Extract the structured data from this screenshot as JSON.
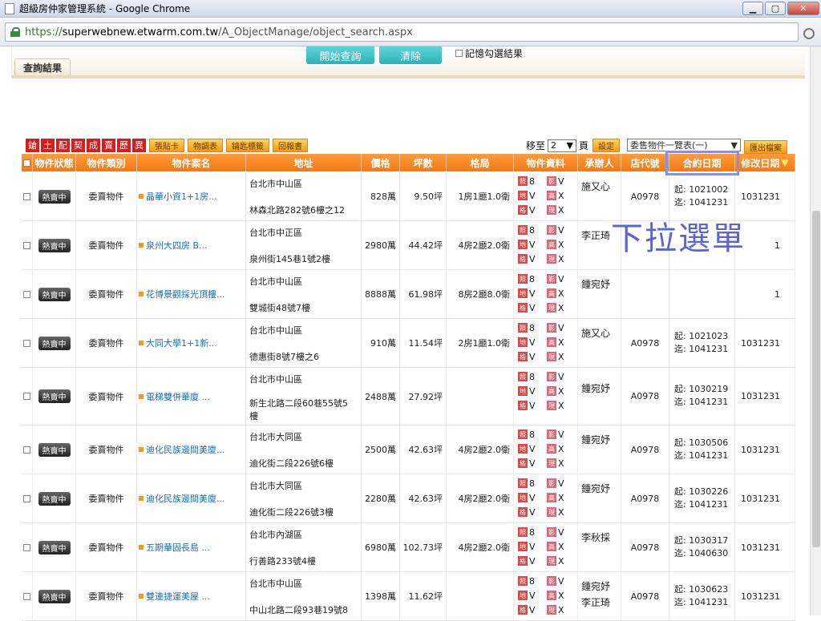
{
  "window": {
    "title": "超級房仲家管理系統 - Google Chrome",
    "min": "▁",
    "max": "▢",
    "close": "✕"
  },
  "address": {
    "scheme": "https://",
    "host": "superwebnew.etwarm.com.tw",
    "path": "/A_ObjectManage/object_search.aspx"
  },
  "search": {
    "start_label": "開始查詢",
    "clear_label": "清除",
    "remember_label": "記憶勾選結果"
  },
  "results": {
    "tab_label": "查詢結果",
    "red_buttons": [
      "鎗",
      "土",
      "配",
      "契",
      "成",
      "賣",
      "歷",
      "異"
    ],
    "orange_buttons": [
      "張貼卡",
      "物調表",
      "鑰匙標籤",
      "回報書"
    ],
    "goto_label": "移至",
    "page_value": "2",
    "page_unit": "頁",
    "set_label": "設定",
    "view_select": "委售物件一覽表(一)",
    "export_label": "匯出檔案"
  },
  "columns": [
    "物件狀態",
    "物件類別",
    "物件案名",
    "地址",
    "價格",
    "坪數",
    "格局",
    "物件資料",
    "承辦人",
    "店代號",
    "合約日期",
    "修改日期"
  ],
  "sort_indicator": "▼",
  "info_labels": {
    "a1": "照",
    "a2": "影",
    "b1": "地",
    "b2": "高",
    "c1": "格",
    "c2": "現"
  },
  "rows": [
    {
      "status": "熱賣中",
      "category": "委賣物件",
      "name": "晶華小資1+1房...",
      "addr1": "台北市中山區",
      "addr2": "林森北路282號6樓之12",
      "price": "828萬",
      "area": "9.50坪",
      "layout": "1房1廳1.0衛",
      "info": [
        "8",
        "V",
        "V",
        "X",
        "V",
        "X"
      ],
      "agent": "施又心",
      "agent2": "",
      "store": "A0978",
      "start": "起: 1021002",
      "end": "迄: 1041231",
      "modified": "1031231"
    },
    {
      "status": "熱賣中",
      "category": "委賣物件",
      "name": "泉州大四房 B...",
      "addr1": "台北市中正區",
      "addr2": "泉州街145巷1號2樓",
      "price": "2980萬",
      "area": "44.42坪",
      "layout": "4房2廳2.0衛",
      "info": [
        "8",
        "V",
        "V",
        "X",
        "V",
        "X"
      ],
      "agent": "李正琦",
      "agent2": "",
      "store": "",
      "start": "",
      "end": "",
      "modified": "1"
    },
    {
      "status": "熱賣中",
      "category": "委賣物件",
      "name": "花博景觀採光頂樓...",
      "addr1": "台北市中山區",
      "addr2": "雙城街48號7樓",
      "price": "8888萬",
      "area": "61.98坪",
      "layout": "8房2廳8.0衛",
      "info": [
        "8",
        "V",
        "V",
        "X",
        "V",
        "X"
      ],
      "agent": "鍾宛妤",
      "agent2": "",
      "store": "",
      "start": "",
      "end": "",
      "modified": "1"
    },
    {
      "status": "熱賣中",
      "category": "委賣物件",
      "name": "大同大學1+1新...",
      "addr1": "台北市中山區",
      "addr2": "德惠街8號7樓之6",
      "price": "910萬",
      "area": "11.54坪",
      "layout": "2房1廳1.0衛",
      "info": [
        "8",
        "V",
        "V",
        "X",
        "V",
        "X"
      ],
      "agent": "施又心",
      "agent2": "",
      "store": "A0978",
      "start": "起: 1021023",
      "end": "迄: 1041231",
      "modified": "1031231"
    },
    {
      "status": "熱賣中",
      "category": "委賣物件",
      "name": "電梯雙併華廈 ...",
      "addr1": "台北市中山區",
      "addr2": "新生北路二段60巷55號5樓",
      "price": "2488萬",
      "area": "27.92坪",
      "layout": "",
      "info": [
        "8",
        "V",
        "V",
        "X",
        "V",
        "X"
      ],
      "agent": "鍾宛妤",
      "agent2": "",
      "store": "A0978",
      "start": "起: 1030219",
      "end": "迄: 1041231",
      "modified": "1031231"
    },
    {
      "status": "熱賣中",
      "category": "委賣物件",
      "name": "迪化民族邊間美廈...",
      "addr1": "台北市大同區",
      "addr2": "迪化街二段226號6樓",
      "price": "2500萬",
      "area": "42.63坪",
      "layout": "4房2廳2.0衛",
      "info": [
        "8",
        "V",
        "V",
        "X",
        "V",
        "X"
      ],
      "agent": "鍾宛妤",
      "agent2": "",
      "store": "A0978",
      "start": "起: 1030506",
      "end": "迄: 1041231",
      "modified": "1031231"
    },
    {
      "status": "熱賣中",
      "category": "委賣物件",
      "name": "迪化民族邊間美廈...",
      "addr1": "台北市大同區",
      "addr2": "迪化街二段226號3樓",
      "price": "2280萬",
      "area": "42.63坪",
      "layout": "4房2廳2.0衛",
      "info": [
        "8",
        "V",
        "V",
        "X",
        "V",
        "X"
      ],
      "agent": "鍾宛妤",
      "agent2": "",
      "store": "A0978",
      "start": "起: 1030226",
      "end": "迄: 1041231",
      "modified": "1031231"
    },
    {
      "status": "熱賣中",
      "category": "委賣物件",
      "name": "五期華固長島 ...",
      "addr1": "台北市內湖區",
      "addr2": "行善路233號4樓",
      "price": "6980萬",
      "area": "102.73坪",
      "layout": "4房2廳2.0衛",
      "info": [
        "8",
        "V",
        "V",
        "X",
        "V",
        "X"
      ],
      "agent": "李秋採",
      "agent2": "",
      "store": "A0978",
      "start": "起: 1030317",
      "end": "迄: 1040630",
      "modified": "1031231"
    },
    {
      "status": "熱賣中",
      "category": "委賣物件",
      "name": "雙連捷運美屋 ...",
      "addr1": "台北市中山區",
      "addr2": "中山北路二段93巷19號8",
      "price": "1398萬",
      "area": "11.62坪",
      "layout": "",
      "info": [
        "8",
        "V",
        "V",
        "X",
        "V",
        "X"
      ],
      "agent": "鍾宛妤",
      "agent2": "李正琦",
      "store": "A0978",
      "start": "起: 1030623",
      "end": "迄: 1041231",
      "modified": "1031231"
    }
  ],
  "annotation": {
    "text": "下拉選單",
    "color": "#5b63d8"
  }
}
